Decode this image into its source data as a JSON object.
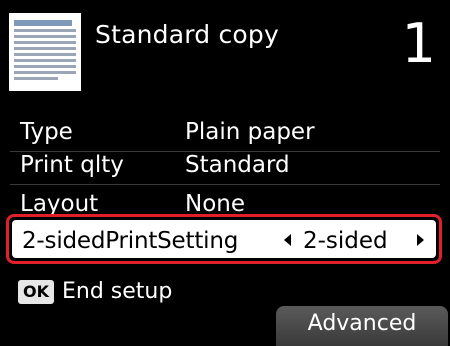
{
  "header": {
    "title": "Standard copy",
    "copies": "1",
    "icon": "document-icon"
  },
  "settings": [
    {
      "label": "Type",
      "value": "Plain paper"
    },
    {
      "label": "Print qlty",
      "value": "Standard"
    },
    {
      "label": "Layout",
      "value": "None"
    }
  ],
  "selected": {
    "label": "2-sidedPrintSetting",
    "value": "2-sided",
    "highlight_color": "#e0202a"
  },
  "footer": {
    "ok_label": "OK",
    "ok_text": "End setup",
    "advanced_label": "Advanced"
  }
}
